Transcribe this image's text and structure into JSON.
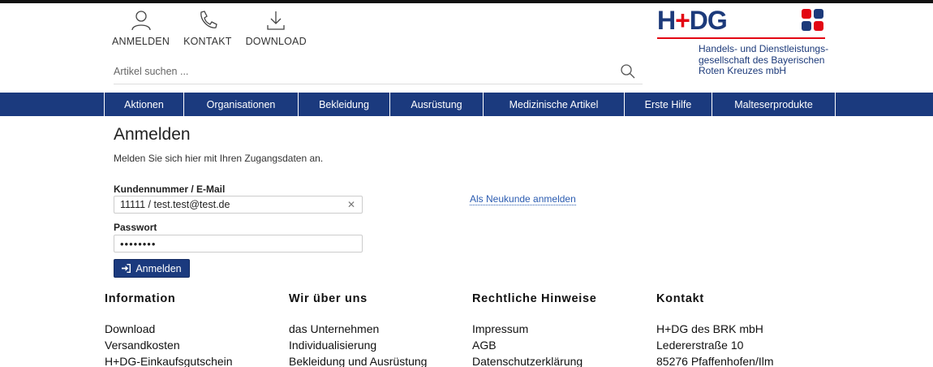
{
  "header": {
    "links": [
      {
        "label": "ANMELDEN",
        "icon": "user-icon"
      },
      {
        "label": "KONTAKT",
        "icon": "phone-icon"
      },
      {
        "label": "DOWNLOAD",
        "icon": "download-icon"
      }
    ],
    "search_placeholder": "Artikel suchen ...",
    "logo": {
      "text_left": "H",
      "text_plus": "+",
      "text_right": "DG",
      "subtitle": [
        "Handels- und Dienstleistungs-",
        "gesellschaft des Bayerischen",
        "Roten Kreuzes mbH"
      ],
      "colors": {
        "navy": "#1c3a7a",
        "red": "#e30613"
      }
    }
  },
  "nav": {
    "items": [
      "Aktionen",
      "Organisationen",
      "Bekleidung",
      "Ausrüstung",
      "Medizinische Artikel",
      "Erste Hilfe",
      "Malteserprodukte"
    ],
    "color": "#1b3a7e"
  },
  "login": {
    "title": "Anmelden",
    "intro": "Melden Sie sich hier mit Ihren Zugangsdaten an.",
    "customer_label": "Kundennummer / E-Mail",
    "customer_value": "11111 / test.test@test.de",
    "password_label": "Passwort",
    "password_value": "••••••••",
    "submit_label": "Anmelden",
    "register_link": "Als Neukunde anmelden"
  },
  "footer": {
    "columns": [
      {
        "title": "Information",
        "links": [
          "Download",
          "Versandkosten",
          "H+DG-Einkaufsgutschein"
        ]
      },
      {
        "title": "Wir über uns",
        "links": [
          "das Unternehmen",
          "Individualisierung",
          "Bekleidung und Ausrüstung"
        ]
      },
      {
        "title": "Rechtliche Hinweise",
        "links": [
          "Impressum",
          "AGB",
          "Datenschutzerklärung"
        ]
      },
      {
        "title": "Kontakt",
        "links": [
          "H+DG des BRK mbH",
          "Ledererstraße 10",
          "85276 Pfaffenhofen/Ilm"
        ]
      }
    ]
  }
}
